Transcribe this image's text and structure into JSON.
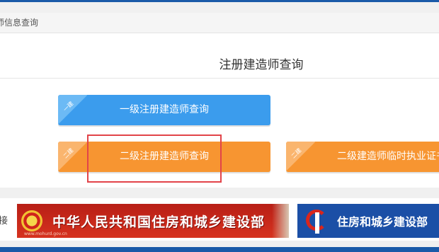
{
  "breadcrumb": {
    "text": "师信息查询"
  },
  "page": {
    "title": "注册建造师查询"
  },
  "buttons": [
    {
      "label": "一级注册建造师查询",
      "tag": "一建",
      "color": "#3b9ced"
    },
    {
      "label": "二级注册建造师查询",
      "tag": "二建",
      "color": "#f79531"
    },
    {
      "label": "二级建造师临时执业证书人",
      "tag": "二建",
      "color": "#f79531"
    }
  ],
  "links": {
    "label": "接",
    "banners": [
      {
        "text": "中华人民共和国住房和城乡建设部",
        "url": "www.mohurd.gov.cn",
        "icon": "national-emblem-icon"
      },
      {
        "text": "住房和城乡建设部",
        "icon": "housing-logo-icon"
      }
    ]
  },
  "colors": {
    "header": "#1a5aa8",
    "highlight": "#e24449"
  }
}
